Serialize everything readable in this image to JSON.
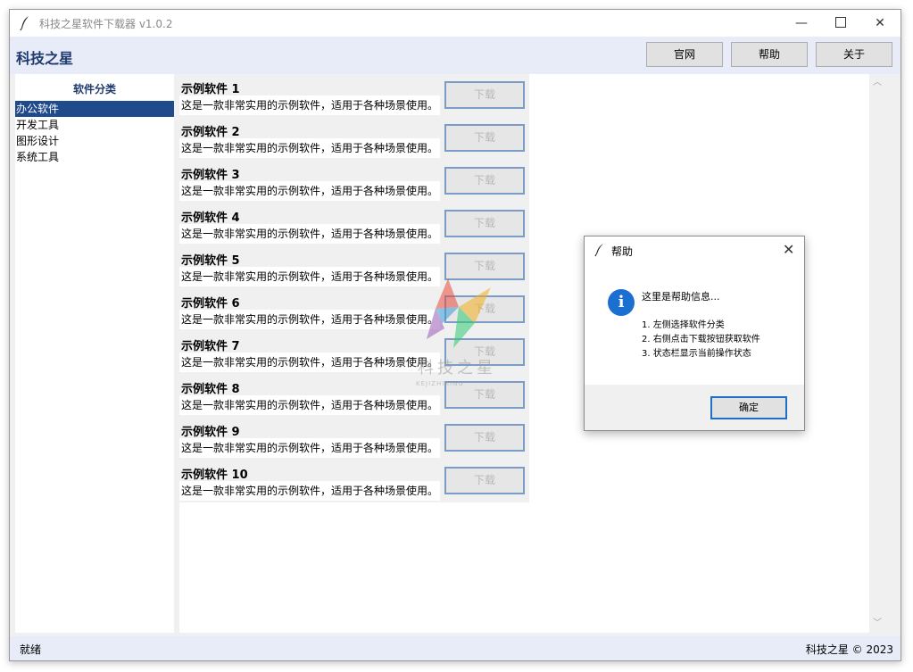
{
  "window": {
    "title": "科技之星软件下载器 v1.0.2",
    "min_glyph": "—",
    "close_glyph": "✕"
  },
  "header": {
    "brand": "科技之星",
    "buttons": [
      "官网",
      "帮助",
      "关于"
    ]
  },
  "sidebar": {
    "title": "软件分类",
    "categories": [
      "办公软件",
      "开发工具",
      "图形设计",
      "系统工具"
    ],
    "selected": "办公软件"
  },
  "items": [
    {
      "name": "示例软件 1",
      "desc": "这是一款非常实用的示例软件，适用于各种场景使用。",
      "button": "下载"
    },
    {
      "name": "示例软件 2",
      "desc": "这是一款非常实用的示例软件，适用于各种场景使用。",
      "button": "下载"
    },
    {
      "name": "示例软件 3",
      "desc": "这是一款非常实用的示例软件，适用于各种场景使用。",
      "button": "下载"
    },
    {
      "name": "示例软件 4",
      "desc": "这是一款非常实用的示例软件，适用于各种场景使用。",
      "button": "下载"
    },
    {
      "name": "示例软件 5",
      "desc": "这是一款非常实用的示例软件，适用于各种场景使用。",
      "button": "下载"
    },
    {
      "name": "示例软件 6",
      "desc": "这是一款非常实用的示例软件，适用于各种场景使用。",
      "button": "下载"
    },
    {
      "name": "示例软件 7",
      "desc": "这是一款非常实用的示例软件，适用于各种场景使用。",
      "button": "下载"
    },
    {
      "name": "示例软件 8",
      "desc": "这是一款非常实用的示例软件，适用于各种场景使用。",
      "button": "下载"
    },
    {
      "name": "示例软件 9",
      "desc": "这是一款非常实用的示例软件，适用于各种场景使用。",
      "button": "下载"
    },
    {
      "name": "示例软件 10",
      "desc": "这是一款非常实用的示例软件，适用于各种场景使用。",
      "button": "下载"
    }
  ],
  "status": {
    "left": "就绪",
    "right": "科技之星 © 2023"
  },
  "watermark": {
    "text": "科技之星",
    "sub": "KEJIZHIXING"
  },
  "dialog": {
    "title": "帮助",
    "icon": "info-icon",
    "message": "这里是帮助信息...",
    "lines": [
      "1. 左侧选择软件分类",
      "2. 右侧点击下载按钮获取软件",
      "3. 状态栏显示当前操作状态"
    ],
    "ok": "确定",
    "close_glyph": "✕"
  },
  "colors": {
    "accent": "#1f3a6e",
    "selection": "#1f4a8c",
    "header_bg": "#e8ecf8",
    "info_blue": "#1b6fd0"
  }
}
